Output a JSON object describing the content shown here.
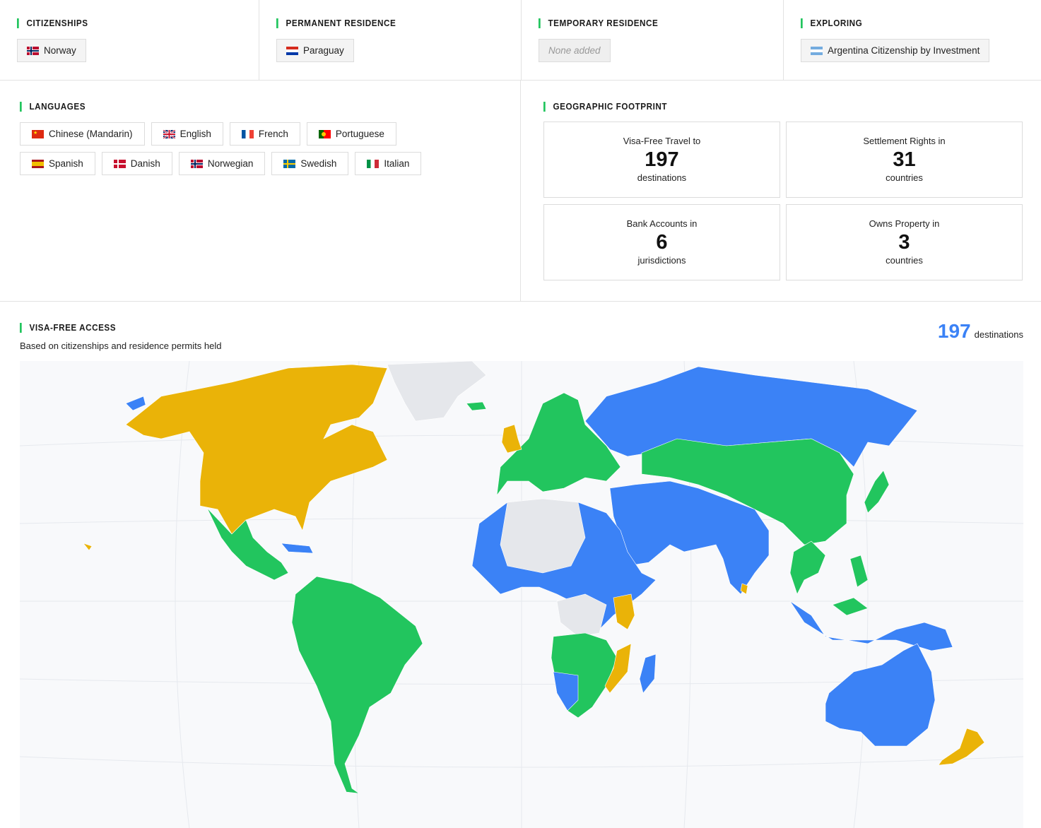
{
  "citizenships": {
    "title": "CITIZENSHIPS",
    "items": [
      {
        "label": "Norway",
        "flag": "norway"
      }
    ]
  },
  "permanent_residence": {
    "title": "PERMANENT RESIDENCE",
    "items": [
      {
        "label": "Paraguay",
        "flag": "paraguay"
      }
    ]
  },
  "temporary_residence": {
    "title": "TEMPORARY RESIDENCE",
    "empty_label": "None added"
  },
  "exploring": {
    "title": "EXPLORING",
    "items": [
      {
        "label": "Argentina Citizenship by Investment",
        "flag": "argentina"
      }
    ]
  },
  "languages": {
    "title": "LANGUAGES",
    "items": [
      {
        "label": "Chinese (Mandarin)",
        "flag": "china"
      },
      {
        "label": "English",
        "flag": "uk"
      },
      {
        "label": "French",
        "flag": "france"
      },
      {
        "label": "Portuguese",
        "flag": "portugal"
      },
      {
        "label": "Spanish",
        "flag": "spain"
      },
      {
        "label": "Danish",
        "flag": "denmark"
      },
      {
        "label": "Norwegian",
        "flag": "norway"
      },
      {
        "label": "Swedish",
        "flag": "sweden"
      },
      {
        "label": "Italian",
        "flag": "italy"
      }
    ]
  },
  "geographic_footprint": {
    "title": "GEOGRAPHIC FOOTPRINT",
    "stats": [
      {
        "label": "Visa-Free Travel to",
        "value": "197",
        "unit": "destinations"
      },
      {
        "label": "Settlement Rights in",
        "value": "31",
        "unit": "countries"
      },
      {
        "label": "Bank Accounts in",
        "value": "6",
        "unit": "jurisdictions"
      },
      {
        "label": "Owns Property in",
        "value": "3",
        "unit": "countries"
      }
    ]
  },
  "visa_free_access": {
    "title": "VISA-FREE ACCESS",
    "subtitle": "Based on citizenships and residence permits held",
    "count": "197",
    "count_unit": "destinations",
    "colors": {
      "visa_free": "#3b82f6",
      "settlement": "#22c55e",
      "property": "#eab308",
      "none": "#e5e7eb",
      "ocean": "#f8f9fb"
    }
  }
}
